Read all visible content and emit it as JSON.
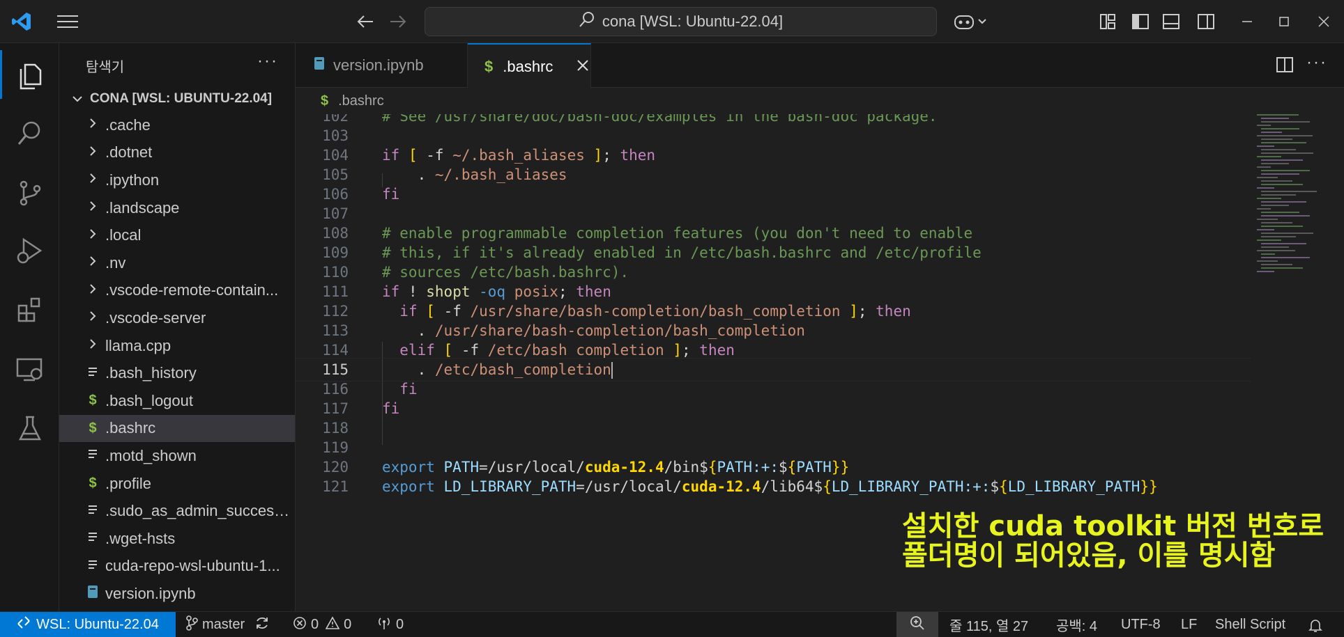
{
  "titlebar": {
    "search_text": "cona [WSL: Ubuntu-22.04]"
  },
  "sidebar": {
    "title": "탐색기",
    "more": "···",
    "root_label": "CONA [WSL: UBUNTU-22.04]",
    "items": [
      {
        "label": ".cache",
        "kind": "folder"
      },
      {
        "label": ".dotnet",
        "kind": "folder"
      },
      {
        "label": ".ipython",
        "kind": "folder"
      },
      {
        "label": ".landscape",
        "kind": "folder"
      },
      {
        "label": ".local",
        "kind": "folder"
      },
      {
        "label": ".nv",
        "kind": "folder"
      },
      {
        "label": ".vscode-remote-contain...",
        "kind": "folder"
      },
      {
        "label": ".vscode-server",
        "kind": "folder"
      },
      {
        "label": "llama.cpp",
        "kind": "folder"
      },
      {
        "label": ".bash_history",
        "kind": "file"
      },
      {
        "label": ".bash_logout",
        "kind": "shell"
      },
      {
        "label": ".bashrc",
        "kind": "shell",
        "selected": true
      },
      {
        "label": ".motd_shown",
        "kind": "file"
      },
      {
        "label": ".profile",
        "kind": "shell"
      },
      {
        "label": ".sudo_as_admin_successful",
        "kind": "file"
      },
      {
        "label": ".wget-hsts",
        "kind": "file"
      },
      {
        "label": "cuda-repo-wsl-ubuntu-1...",
        "kind": "file"
      },
      {
        "label": "version.ipynb",
        "kind": "notebook"
      }
    ]
  },
  "tabs": [
    {
      "label": "version.ipynb",
      "active": false
    },
    {
      "label": ".bashrc",
      "active": true
    }
  ],
  "breadcrumb": {
    "file": ".bashrc"
  },
  "code": {
    "current_line": "115",
    "lines": [
      {
        "n": "102",
        "text": "# See /usr/share/doc/bash-doc/examples in the bash-doc package."
      },
      {
        "n": "103",
        "text": ""
      },
      {
        "n": "104",
        "text": "if [ -f ~/.bash_aliases ]; then"
      },
      {
        "n": "105",
        "text": "    . ~/.bash_aliases"
      },
      {
        "n": "106",
        "text": "fi"
      },
      {
        "n": "107",
        "text": ""
      },
      {
        "n": "108",
        "text": "# enable programmable completion features (you don't need to enable"
      },
      {
        "n": "109",
        "text": "# this, if it's already enabled in /etc/bash.bashrc and /etc/profile"
      },
      {
        "n": "110",
        "text": "# sources /etc/bash.bashrc)."
      },
      {
        "n": "111",
        "text": "if ! shopt -oq posix; then"
      },
      {
        "n": "112",
        "text": "  if [ -f /usr/share/bash-completion/bash_completion ]; then"
      },
      {
        "n": "113",
        "text": "    . /usr/share/bash-completion/bash_completion"
      },
      {
        "n": "114",
        "text": "  elif [ -f /etc/bash_completion ]; then"
      },
      {
        "n": "115",
        "text": "    . /etc/bash_completion"
      },
      {
        "n": "116",
        "text": "  fi"
      },
      {
        "n": "117",
        "text": "fi"
      },
      {
        "n": "118",
        "text": ""
      },
      {
        "n": "119",
        "text": ""
      },
      {
        "n": "120",
        "text": "export PATH=/usr/local/cuda-12.4/bin${PATH:+:${PATH}}"
      },
      {
        "n": "121",
        "text": "export LD_LIBRARY_PATH=/usr/local/cuda-12.4/lib64${LD_LIBRARY_PATH:+:${LD_LIBRARY_PATH}}"
      }
    ]
  },
  "annotation": {
    "line1": "설치한 cuda toolkit 버전 번호로",
    "line2": "폴더명이 되어있음, 이를 명시함"
  },
  "statusbar": {
    "remote": "WSL: Ubuntu-22.04",
    "branch": "master",
    "errors": "0",
    "warnings": "0",
    "ports": "0",
    "position": "줄 115, 열 27",
    "spaces": "공백: 4",
    "encoding": "UTF-8",
    "eol": "LF",
    "language": "Shell Script"
  },
  "colors": {
    "accent": "#0078d4",
    "annotation": "#e8f51c",
    "shell_icon": "#8dc149"
  }
}
